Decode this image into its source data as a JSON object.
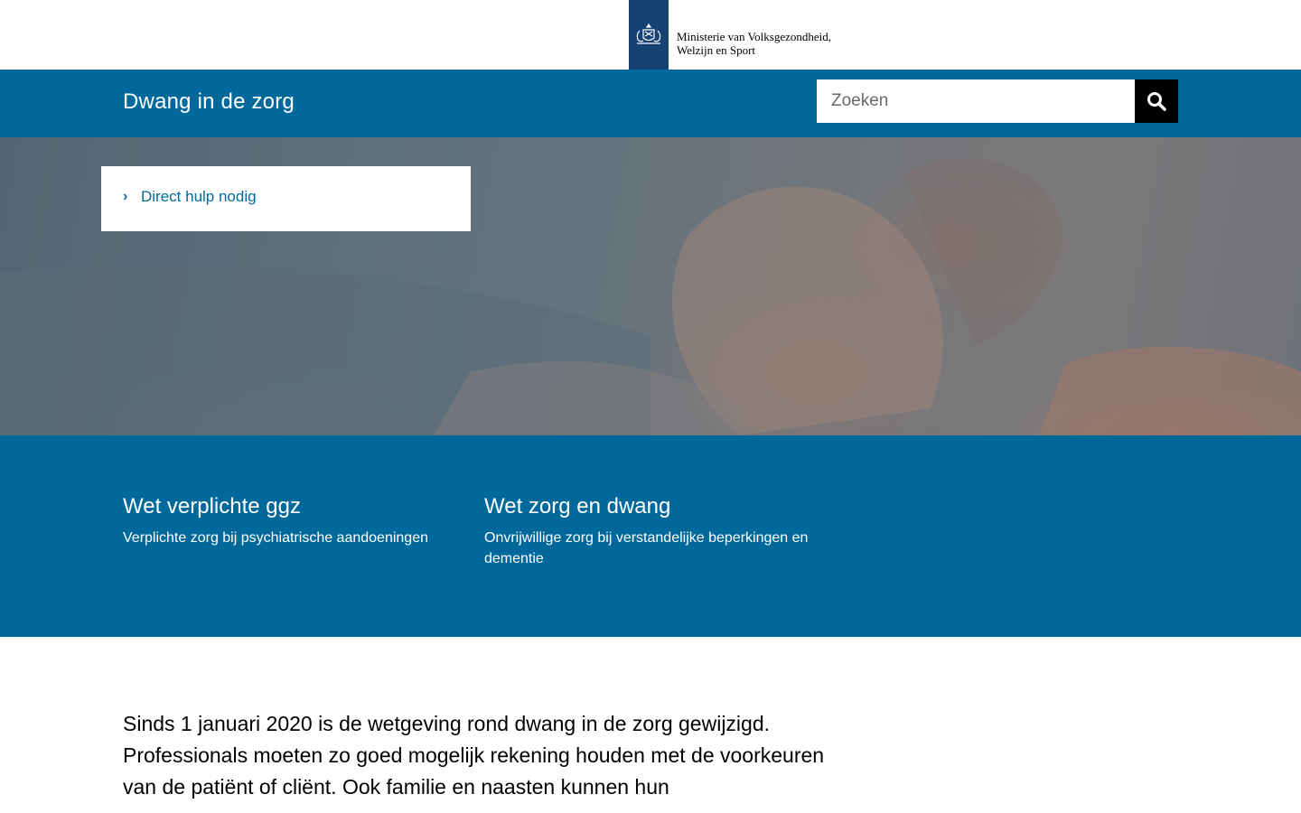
{
  "logo": {
    "emblem": "rijkswapen-emblem",
    "line1": "Ministerie van Volksgezondheid,",
    "line2": "Welzijn en Sport",
    "brand_color": "#154273"
  },
  "header": {
    "title": "Dwang in de zorg",
    "background": "#01689b",
    "search": {
      "placeholder": "Zoeken",
      "value": "",
      "button_icon": "search-icon"
    }
  },
  "hero": {
    "quick_link": {
      "icon": "chevron-right-icon",
      "label": "Direct hulp nodig"
    }
  },
  "topics": [
    {
      "title": "Wet verplichte ggz",
      "description": "Verplichte zorg bij psychiatrische aandoeningen"
    },
    {
      "title": "Wet zorg en dwang",
      "description": "Onvrijwillige zorg bij verstandelijke beperkingen en dementie"
    }
  ],
  "intro": {
    "text": "Sinds 1 januari 2020 is de wetgeving rond dwang in de zorg gewijzigd. Professionals moeten zo goed mogelijk rekening houden met de voorkeuren van de patiënt of cliënt. Ook familie en naasten kunnen hun"
  }
}
